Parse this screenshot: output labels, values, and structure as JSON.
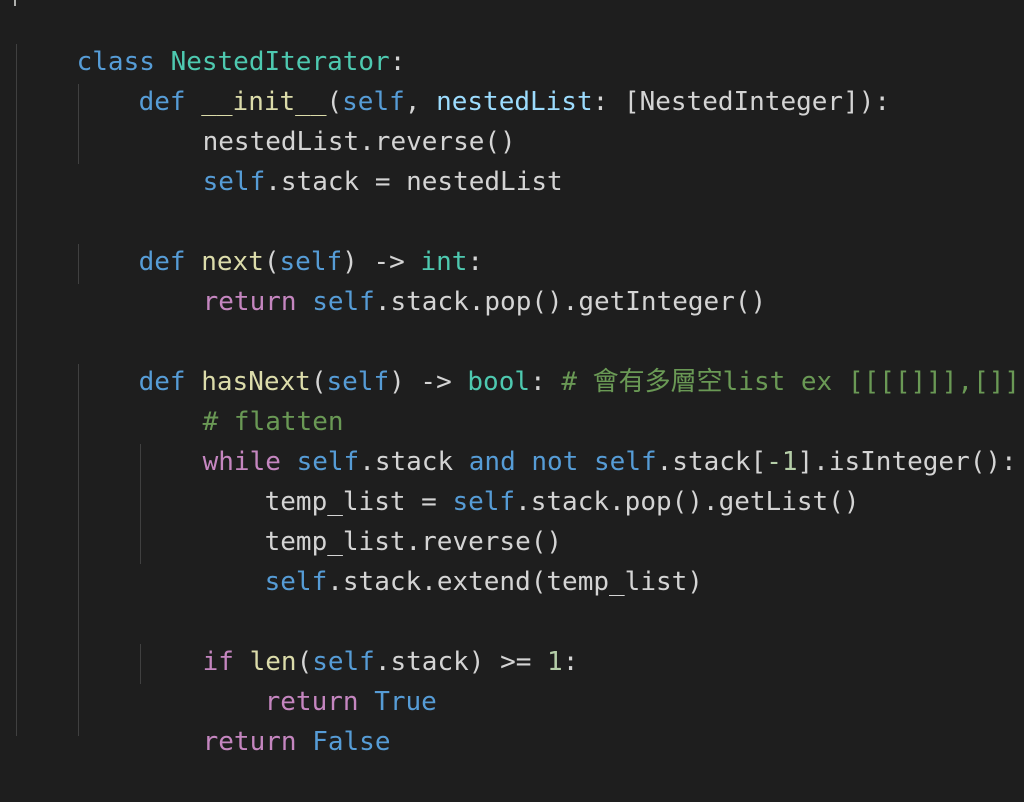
{
  "code_lines": [
    [
      "class",
      " ",
      "NestedIterator",
      ":"
    ],
    [
      "def",
      " ",
      "__init__",
      "(",
      "self",
      ", ",
      "nestedList",
      ": [NestedInteger]):"
    ],
    [
      "nestedList.reverse()"
    ],
    [
      "self",
      ".stack = nestedList"
    ],
    [
      "def",
      " ",
      "next",
      "(",
      "self",
      ") -> ",
      "int",
      ":"
    ],
    [
      "return",
      " ",
      "self",
      ".stack.pop().getInteger()"
    ],
    [
      "def",
      " ",
      "hasNext",
      "(",
      "self",
      ") -> ",
      "bool",
      ": ",
      "# 會有多層空list ex [[[[]]],[]]"
    ],
    [
      "# flatten"
    ],
    [
      "while",
      " ",
      "self",
      ".stack ",
      "and",
      " ",
      "not",
      " ",
      "self",
      ".stack[",
      "-1",
      "].isInteger():"
    ],
    [
      "temp_list = ",
      "self",
      ".stack.pop().getList()"
    ],
    [
      "temp_list.reverse()"
    ],
    [
      "self",
      ".stack.extend(temp_list)"
    ],
    [
      "if",
      " ",
      "len",
      "(",
      "self",
      ".stack) >= ",
      "1",
      ":"
    ],
    [
      "return",
      " ",
      "True"
    ],
    [
      "return",
      " ",
      "False"
    ]
  ],
  "colors": {
    "background": "#1e1e1e",
    "keyword": "#569cd6",
    "control": "#c586c0",
    "class_name": "#4ec9b0",
    "function": "#dcdcaa",
    "variable": "#9cdcfe",
    "number": "#b5cea8",
    "comment": "#6a9955",
    "text": "#d4d4d4"
  }
}
